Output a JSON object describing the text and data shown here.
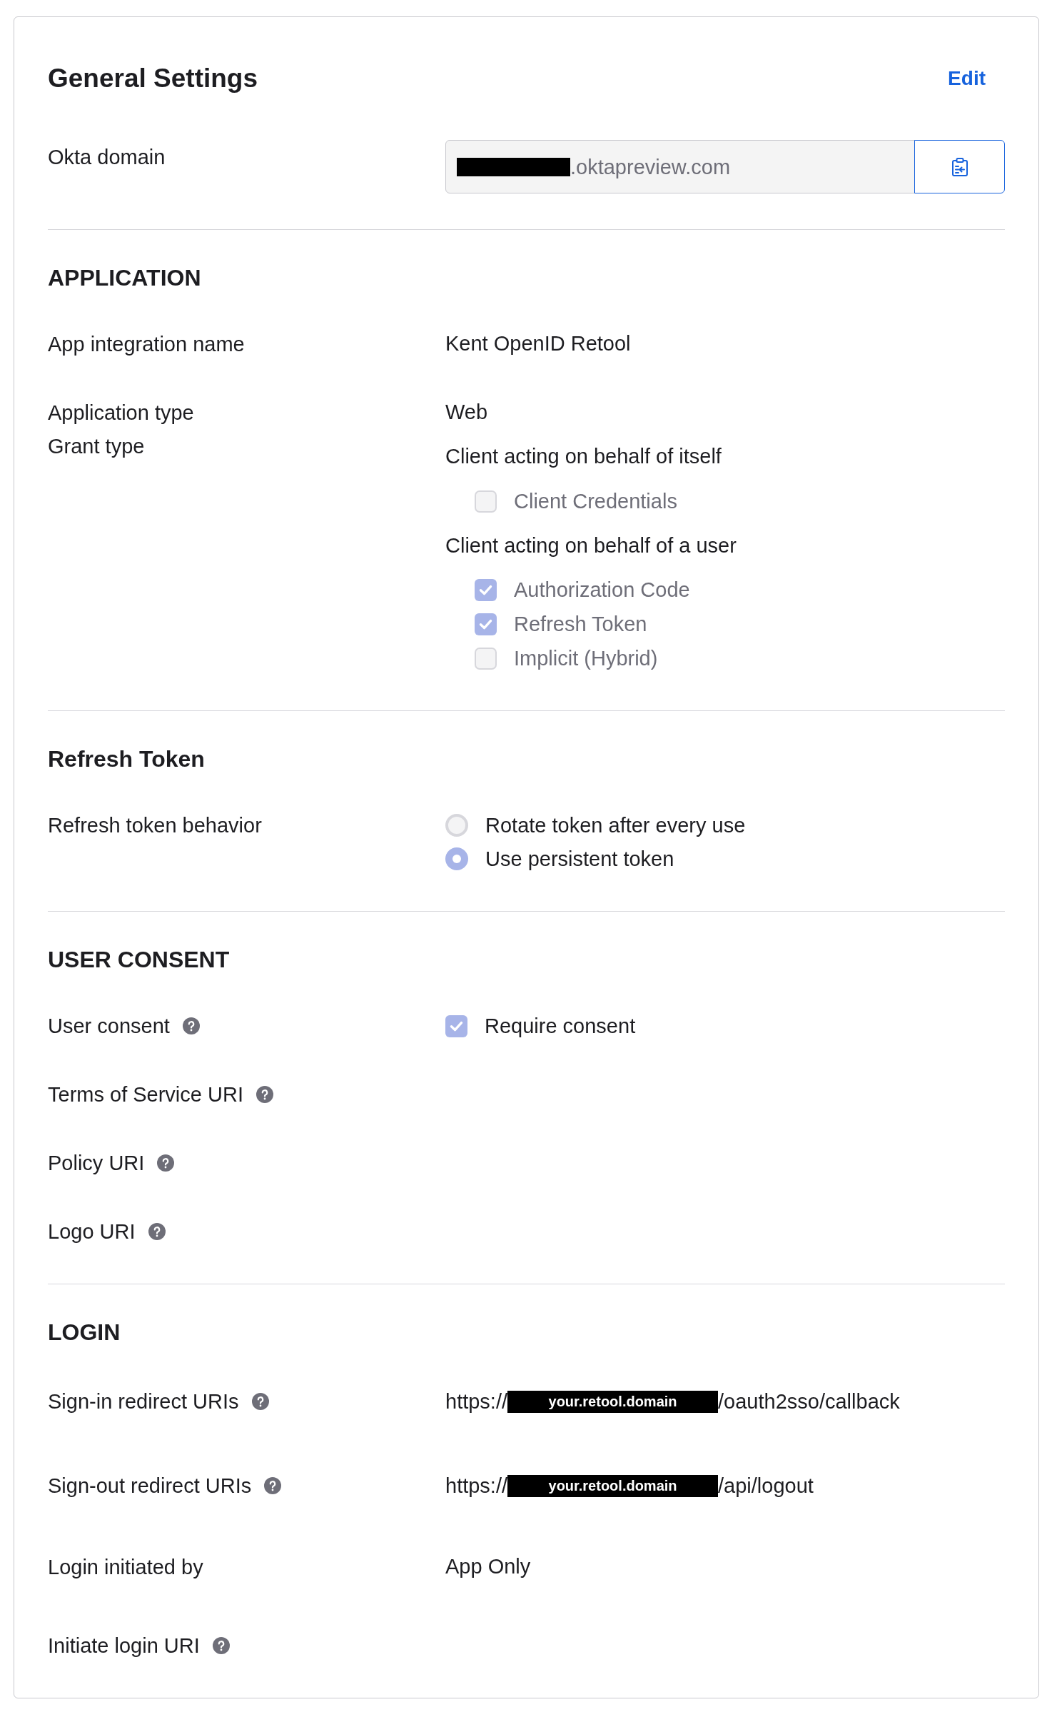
{
  "card": {
    "title": "General Settings",
    "edit_link": "Edit"
  },
  "okta_domain": {
    "label": "Okta domain",
    "value": ".oktapreview.com"
  },
  "sections": [
    {
      "title": "APPLICATION",
      "rows": [
        {
          "kind": "text",
          "label": "App integration name",
          "help_icon": false,
          "value": "Kent OpenID Retool"
        },
        {
          "kind": "text",
          "label": "Application type",
          "help_icon": false,
          "value": "Web"
        },
        {
          "kind": "checkgroups",
          "label": "Grant type",
          "help_icon": false,
          "groups": [
            {
              "heading": "Client acting on behalf of itself",
              "options": [
                {
                  "label": "Client Credentials",
                  "checked": false,
                  "disabled": true
                }
              ]
            },
            {
              "heading": "Client acting on behalf of a user",
              "options": [
                {
                  "label": "Authorization Code",
                  "checked": true,
                  "disabled": true
                },
                {
                  "label": "Refresh Token",
                  "checked": true,
                  "disabled": true
                },
                {
                  "label": "Implicit (Hybrid)",
                  "checked": false,
                  "disabled": true
                }
              ]
            }
          ]
        }
      ]
    },
    {
      "title": "Refresh Token",
      "rows": [
        {
          "kind": "radios",
          "label": "Refresh token behavior",
          "help_icon": false,
          "options": [
            {
              "label": "Rotate token after every use",
              "selected": false
            },
            {
              "label": "Use persistent token",
              "selected": true
            }
          ]
        }
      ]
    },
    {
      "title": "USER CONSENT",
      "rows": [
        {
          "kind": "checkbox",
          "label": "User consent",
          "help_icon": true,
          "option": {
            "label": "Require consent",
            "checked": true
          }
        },
        {
          "kind": "text",
          "label": "Terms of Service URI",
          "help_icon": true
        },
        {
          "kind": "text",
          "label": "Policy URI",
          "help_icon": true
        },
        {
          "kind": "text",
          "label": "Logo URI",
          "help_icon": true
        }
      ]
    },
    {
      "title": "LOGIN",
      "rows": [
        {
          "kind": "uri",
          "label": "Sign-in redirect URIs",
          "help_icon": true,
          "prefix": "https://",
          "boxed_text": "your.retool.domain",
          "suffix": "/oauth2sso/callback"
        },
        {
          "kind": "uri",
          "label": "Sign-out redirect URIs",
          "help_icon": true,
          "prefix": "https://",
          "boxed_text": "your.retool.domain",
          "suffix": "/api/logout"
        },
        {
          "kind": "text",
          "label": "Login initiated by",
          "help_icon": false,
          "value": "App Only"
        },
        {
          "kind": "text",
          "label": "Initiate login URI",
          "help_icon": true
        }
      ]
    }
  ]
}
